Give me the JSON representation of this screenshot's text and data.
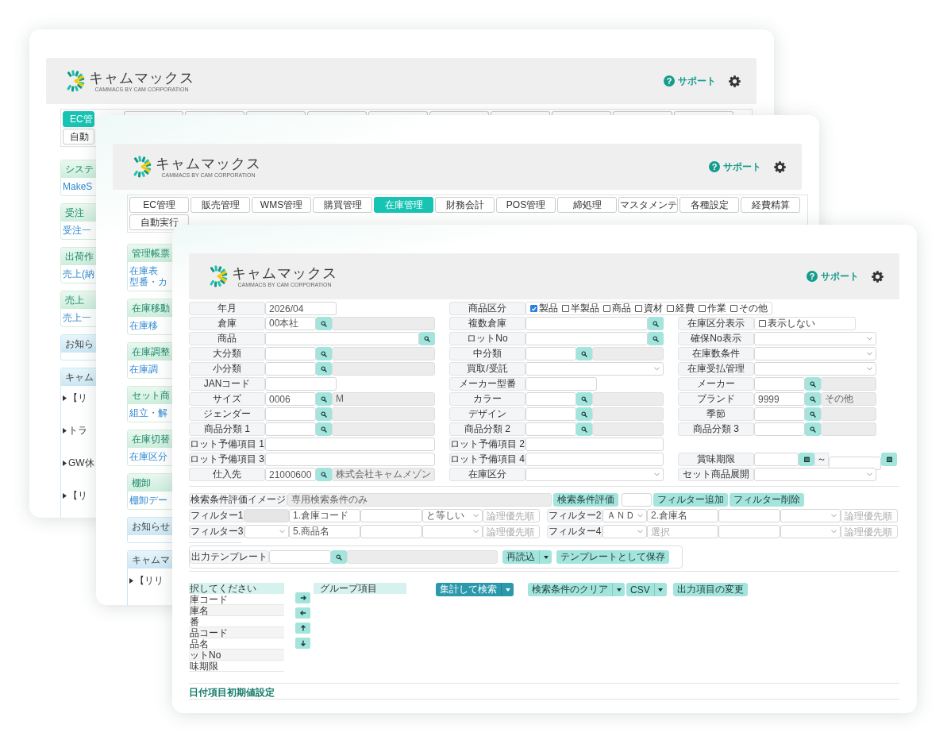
{
  "windows": [
    {
      "kind": "back",
      "header": {
        "logo_text": "キャムマックス",
        "logo_subtitle": "CAMMACS BY CAM CORPORATION",
        "support_icon": "?",
        "support_link": "サポート"
      },
      "tabs": [
        {
          "label": "EC管",
          "selected": true
        },
        {
          "selected": false
        },
        {
          "selected": false
        },
        {
          "selected": false
        },
        {
          "selected": false
        },
        {
          "selected": false
        },
        {
          "selected": false
        },
        {
          "selected": false
        },
        {
          "selected": false
        },
        {
          "selected": false
        },
        {
          "selected": false
        },
        {
          "label": "自動",
          "selected": false
        }
      ],
      "sidebar": [
        {
          "title": "システ",
          "kind": "menu",
          "items": [
            "MakeS"
          ]
        },
        {
          "title": "受注",
          "kind": "menu",
          "items": [
            "受注一"
          ]
        },
        {
          "title": "出荷作",
          "kind": "menu",
          "items": [
            "売上(納"
          ]
        },
        {
          "title": "売上",
          "kind": "menu",
          "items": [
            "売上一"
          ]
        },
        {
          "title": "お知ら",
          "kind": "notice"
        },
        {
          "title": "キャム",
          "kind": "notice",
          "items": [
            "【リ",
            "トラ",
            "GW休",
            "【リ"
          ]
        }
      ]
    },
    {
      "kind": "middle",
      "header": {
        "logo_text": "キャムマックス",
        "logo_subtitle": "CAMMACS BY CAM CORPORATION",
        "support_icon": "?",
        "support_link": "サポート"
      },
      "tabs": [
        {
          "label": "EC管理",
          "selected": false
        },
        {
          "label": "販売管理",
          "selected": false
        },
        {
          "label": "WMS管理",
          "selected": false
        },
        {
          "label": "購買管理",
          "selected": false
        },
        {
          "label": "在庫管理",
          "selected": true
        },
        {
          "label": "財務会計",
          "selected": false
        },
        {
          "label": "POS管理",
          "selected": false
        },
        {
          "label": "締処理",
          "selected": false
        },
        {
          "label": "マスタメンテ",
          "selected": false
        },
        {
          "label": "各種設定",
          "selected": false
        },
        {
          "label": "経費精算",
          "selected": false
        },
        {
          "label": "自動実行",
          "selected": false
        }
      ],
      "sidebar": [
        {
          "title": "管理帳票",
          "kind": "menu",
          "items": [
            "在庫表",
            "型番・カ"
          ]
        },
        {
          "title": "在庫移動",
          "kind": "menu",
          "items": [
            "在庫移"
          ]
        },
        {
          "title": "在庫調整",
          "kind": "menu",
          "items": [
            "在庫調"
          ]
        },
        {
          "title": "セット商",
          "kind": "menu",
          "items": [
            "組立・解"
          ]
        },
        {
          "title": "在庫切替",
          "kind": "menu",
          "items": [
            "在庫区分"
          ]
        },
        {
          "title": "棚卸",
          "kind": "menu",
          "items": [
            "棚卸デー"
          ]
        },
        {
          "title": "お知らせ",
          "kind": "notice"
        },
        {
          "title": "キャムマ",
          "kind": "notice",
          "items": [
            "【リリ"
          ]
        }
      ]
    },
    {
      "kind": "front",
      "header": {
        "logo_text": "キャムマックス",
        "logo_subtitle": "CAMMACS BY CAM CORPORATION",
        "support_icon": "?",
        "support_link": "サポート"
      },
      "form_rows": [
        {
          "left": {
            "label": "年月",
            "kind": "text",
            "value": "2026/04"
          },
          "middle": {
            "label": "商品区分",
            "kind": "checks",
            "options": [
              {
                "label": "製品",
                "checked": true
              },
              {
                "label": "半製品",
                "checked": false
              },
              {
                "label": "商品",
                "checked": false
              },
              {
                "label": "資材",
                "checked": false
              },
              {
                "label": "経費",
                "checked": false
              },
              {
                "label": "作業",
                "checked": false
              },
              {
                "label": "その他",
                "checked": false
              }
            ]
          }
        },
        {
          "left": {
            "label": "倉庫",
            "kind": "lookup",
            "value": "00本社"
          },
          "middle": {
            "label": "複数倉庫",
            "kind": "search"
          },
          "right": {
            "label": "在庫区分表示",
            "kind": "check",
            "option": {
              "label": "表示しない",
              "checked": false
            }
          }
        },
        {
          "left": {
            "label": "商品",
            "kind": "search"
          },
          "middle": {
            "label": "ロットNo",
            "kind": "search"
          },
          "right": {
            "label": "確保No表示",
            "kind": "select"
          }
        },
        {
          "left": {
            "label": "大分類",
            "kind": "lookup"
          },
          "middle": {
            "label": "中分類",
            "kind": "lookup"
          },
          "right": {
            "label": "在庫数条件",
            "kind": "select"
          }
        },
        {
          "left": {
            "label": "小分類",
            "kind": "lookup"
          },
          "middle": {
            "label": "買取/受託",
            "kind": "select"
          },
          "right": {
            "label": "在庫受払管理",
            "kind": "select"
          }
        },
        {
          "left": {
            "label": "JANコード",
            "kind": "text"
          },
          "middle": {
            "label": "メーカー型番",
            "kind": "text"
          },
          "right": {
            "label": "メーカー",
            "kind": "lookup"
          }
        },
        {
          "left": {
            "label": "サイズ",
            "kind": "lookup",
            "value": "0006",
            "display": "M"
          },
          "middle": {
            "label": "カラー",
            "kind": "lookup"
          },
          "right": {
            "label": "ブランド",
            "kind": "lookup",
            "value": "9999",
            "display": "その他"
          }
        },
        {
          "left": {
            "label": "ジェンダー",
            "kind": "lookup"
          },
          "middle": {
            "label": "デザイン",
            "kind": "lookup"
          },
          "right": {
            "label": "季節",
            "kind": "lookup"
          }
        },
        {
          "left": {
            "label": "商品分類 1",
            "kind": "lookup"
          },
          "middle": {
            "label": "商品分類 2",
            "kind": "lookup"
          },
          "right": {
            "label": "商品分類 3",
            "kind": "lookup"
          }
        },
        {
          "left": {
            "label": "ロット予備項目 1",
            "kind": "wide"
          },
          "middle": {
            "label": "ロット予備項目 2",
            "kind": "wide"
          }
        },
        {
          "left": {
            "label": "ロット予備項目 3",
            "kind": "wide"
          },
          "middle": {
            "label": "ロット予備項目 4",
            "kind": "wide"
          },
          "right": {
            "label": "賞味期限",
            "kind": "date_range",
            "separator": "～"
          }
        },
        {
          "left": {
            "label": "仕入先",
            "kind": "lookup",
            "value": "21000600",
            "display": "株式会社キャムメゾン"
          },
          "middle": {
            "label": "在庫区分",
            "kind": "select"
          },
          "right": {
            "label": "セット商品展開",
            "kind": "select"
          }
        }
      ],
      "evaluation": {
        "label": "検索条件評価イメージ",
        "value": "専用検索条件のみ",
        "evaluate_button": "検索条件評価",
        "add_button": "フィルター追加",
        "delete_button": "フィルター削除"
      },
      "filters": [
        {
          "label": "フィルター1",
          "kind": "locked",
          "field": "1.倉庫コード",
          "operator": "と等しい",
          "priority_placeholder": "論理優先順"
        },
        {
          "label": "フィルター2",
          "kind": "select",
          "connector": "ＡＮＤ",
          "field": "2.倉庫名",
          "priority_placeholder": "論理優先順"
        },
        {
          "label": "フィルター3",
          "kind": "select",
          "field": "5.商品名",
          "priority_placeholder": "論理優先順"
        },
        {
          "label": "フィルター4",
          "kind": "select",
          "field_placeholder": "選択",
          "priority_placeholder": "論理優先順"
        }
      ],
      "template": {
        "label": "出力テンプレート",
        "reload_button": "再読込",
        "save_button": "テンプレートとして保存"
      },
      "available_list": {
        "title": "択してください",
        "items": [
          "庫コード",
          "庫名",
          "番",
          "品コード",
          "品名",
          "ットNo",
          "味期限"
        ]
      },
      "group_list": {
        "title": "グループ項目"
      },
      "actions": {
        "search_button": "集計して検索",
        "clear_button": "検索条件のクリア",
        "csv_button": "CSV",
        "columns_button": "出力項目の変更"
      },
      "section_title": "日付項目初期値設定"
    }
  ]
}
